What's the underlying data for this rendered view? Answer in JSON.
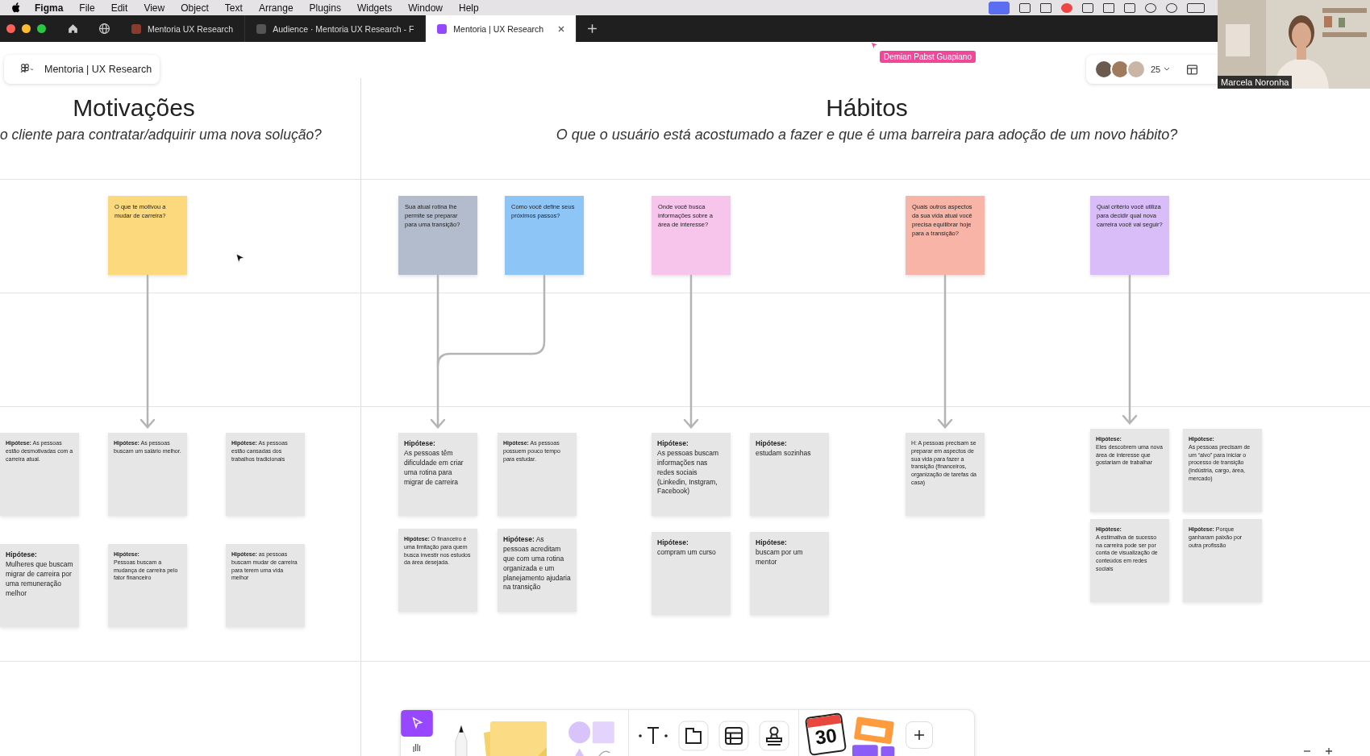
{
  "menubar": {
    "app": "Figma",
    "items": [
      "File",
      "Edit",
      "View",
      "Object",
      "Text",
      "Arrange",
      "Plugins",
      "Widgets",
      "Window",
      "Help"
    ]
  },
  "tabs": [
    {
      "label": "Mentoria UX Research",
      "selected": false,
      "kind": "file"
    },
    {
      "label": "Audience · Mentoria UX Research - F",
      "selected": false,
      "kind": "video"
    },
    {
      "label": "Mentoria | UX Research",
      "selected": true,
      "kind": "board"
    }
  ],
  "file_name": "Mentoria | UX Research",
  "collaborator_cursor": {
    "name": "Demian Pabst Guapiano"
  },
  "collaborators": {
    "count": "25"
  },
  "video": {
    "name": "Marcela Noronha"
  },
  "columns": [
    {
      "title": "Motivações",
      "subtitle": "o cliente para contratar/adquirir uma nova solução?",
      "stickies": [
        {
          "text": "O que te motivou a mudar de carreira?",
          "color": "#fbd97c"
        }
      ],
      "cards": [
        {
          "text": "**Hipótese:** As pessoas estão desmotivadas com a carreira atual.",
          "kind": "small"
        },
        {
          "text": "**Hipótese:** As pessoas buscam um salário melhor.",
          "kind": "small"
        },
        {
          "text": "**Hipótese:** As pessoas estão cansadas dos trabalhos tradicionais",
          "kind": "small"
        },
        {
          "heading": "Hipótese:",
          "text": "Mulheres que buscam migrar de carreira por uma remuneração melhor",
          "kind": "large"
        },
        {
          "heading": "Hipótese:",
          "text": "Pessoas buscam a mudança de carreira pelo fator financeiro",
          "kind": "small"
        },
        {
          "text": "**Hipótese:** as pessoas buscam mudar de carreira para terem uma vida melhor",
          "kind": "small"
        }
      ]
    },
    {
      "title": "Hábitos",
      "subtitle": "O que o usuário está acostumado a fazer e que é uma barreira para adoção de um novo hábito?",
      "stickies": [
        {
          "text": "Sua atual rotina lhe permite se preparar para uma transição?",
          "color": "#b3bccc"
        },
        {
          "text": "Como você define seus próximos passos?",
          "color": "#8ec5f7"
        },
        {
          "text": "Onde você busca informações sobre a área de interesse?",
          "color": "#f7c4ec"
        },
        {
          "text": "Quais outros aspectos da sua vida atual você precisa equilibrar hoje para a transição?",
          "color": "#f8b5a7"
        },
        {
          "text": "Qual critério você utiliza para decidir qual nova carreira você vai seguir?",
          "color": "#d8bdf8"
        }
      ],
      "cards": [
        {
          "heading": "Hipótese:",
          "text": "As pessoas têm dificuldade em criar uma rotina para migrar de carreira",
          "kind": "large"
        },
        {
          "text": "**Hipótese:** As pessoas possuem pouco tempo para estudar.",
          "kind": "small"
        },
        {
          "text": "**Hipótese:** O financeiro é uma limitação para quem busca investir nos estudos da área desejada.",
          "kind": "small"
        },
        {
          "text": "**Hipótese:** As pessoas acreditam que com uma rotina organizada e um planejamento ajudaria na transição",
          "kind": "large"
        },
        {
          "heading": "Hipótese:",
          "text": "As pessoas buscam informações nas redes sociais (Linkedin, Instgram, Facebook)",
          "kind": "large"
        },
        {
          "heading": "Hipótese:",
          "text": "estudam sozinhas",
          "kind": "large"
        },
        {
          "heading": "Hipótese:",
          "text": "compram um curso",
          "kind": "large"
        },
        {
          "heading": "Hipótese:",
          "text": "buscam por um mentor",
          "kind": "large"
        },
        {
          "text": "H: A pessoas precisam se preparar em aspectos de sua vida para fazer a transição (financeiros, organização de tarefas da casa)",
          "kind": "small"
        },
        {
          "heading": "Hipótese:",
          "text": "Eles descobrem uma nova área de interesse que gostariam de trabalhar",
          "kind": "small"
        },
        {
          "heading": "Hipótese:",
          "text": "As pessoas precisam de um “alvo” para iniciar o processo de transição (indústria, cargo, área, mercado)",
          "kind": "small"
        },
        {
          "heading": "Hipótese:",
          "text": "A estimativa de sucesso na carreira pode ser por conta de visualização de conteúdos em redes sociais",
          "kind": "small"
        },
        {
          "text": "**Hipótese:** Porque ganharam paixão por outra profissão",
          "kind": "small"
        }
      ]
    }
  ],
  "toolbar": {
    "sticker": "30"
  }
}
